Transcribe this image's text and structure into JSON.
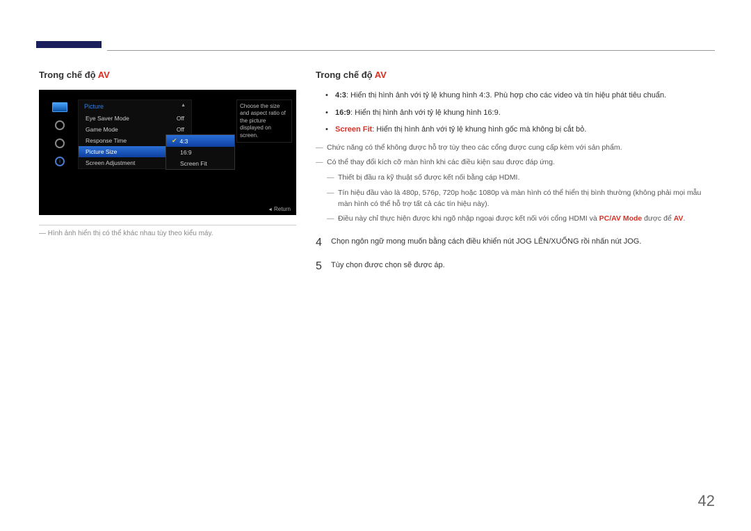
{
  "left": {
    "title_prefix": "Trong chế độ ",
    "title_mode": "AV",
    "osd": {
      "menu_title": "Picture",
      "items": [
        {
          "label": "Eye Saver Mode",
          "value": "Off"
        },
        {
          "label": "Game Mode",
          "value": "Off"
        },
        {
          "label": "Response Time",
          "value": ""
        },
        {
          "label": "Picture Size",
          "value": ""
        },
        {
          "label": "Screen Adjustment",
          "value": ""
        }
      ],
      "submenu": [
        "4:3",
        "16:9",
        "Screen Fit"
      ],
      "description": "Choose the size and aspect ratio of the picture displayed on screen.",
      "return": "Return",
      "up_arrow": "▲"
    },
    "footnote": "Hình ảnh hiển thị có thể khác nhau tùy theo kiểu máy."
  },
  "right": {
    "title_prefix": "Trong chế độ ",
    "title_mode": "AV",
    "bullets": [
      {
        "label": "4:3",
        "text": ": Hiển thị hình ảnh với tỷ lệ khung hình 4:3. Phù hợp cho các video và tín hiệu phát tiêu chuẩn."
      },
      {
        "label": "16:9",
        "text": ": Hiển thị hình ảnh với tỷ lệ khung hình 16:9."
      },
      {
        "label": "Screen Fit",
        "text": ": Hiển thị hình ảnh với tỷ lệ khung hình gốc mà không bị cắt bỏ."
      }
    ],
    "dashes": [
      "Chức năng có thể không được hỗ trợ tùy theo các cổng được cung cấp kèm với sản phẩm.",
      "Có thể thay đổi kích cỡ màn hình khi các điều kiện sau được đáp ứng."
    ],
    "sub_dashes": [
      "Thiết bị đầu ra kỹ thuật số được kết nối bằng cáp HDMI.",
      "Tín hiệu đầu vào là 480p, 576p, 720p hoặc 1080p và màn hình có thể hiển thị bình thường (không phải mọi mẫu màn hình có thể hỗ trợ tất cả các tín hiệu này).",
      {
        "pre": "Điều này chỉ thực hiện được khi ngõ nhập ngoại được kết nối với cổng HDMI và ",
        "red1": "PC/AV Mode",
        "mid": " được để ",
        "red2": "AV",
        "post": "."
      }
    ],
    "steps": [
      {
        "n": "4",
        "t": "Chọn ngôn ngữ mong muốn bằng cách điều khiển nút JOG LÊN/XUỐNG rồi nhấn nút JOG."
      },
      {
        "n": "5",
        "t": "Tùy chọn được chọn sẽ được áp."
      }
    ]
  },
  "page": "42"
}
